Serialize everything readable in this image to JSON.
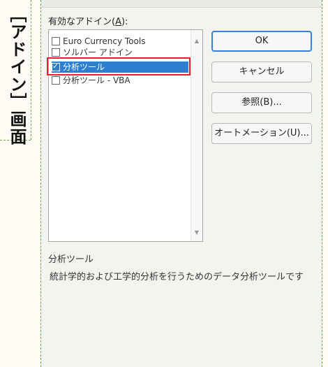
{
  "caption": "［アドイン］画面",
  "dialog": {
    "list_label": "有効なアドイン(",
    "list_label_key": "A",
    "list_label_end": "):",
    "addins": [
      {
        "label": "Euro Currency Tools",
        "checked": false,
        "selected": false
      },
      {
        "label": "ソルバー アドイン",
        "checked": false,
        "selected": false
      },
      {
        "label": "分析ツール",
        "checked": true,
        "selected": true
      },
      {
        "label": "分析ツール - VBA",
        "checked": false,
        "selected": false
      }
    ],
    "buttons": {
      "ok": "OK",
      "cancel": "キャンセル",
      "browse": "参照(B)...",
      "automation": "オートメーション(U)..."
    },
    "description": {
      "title": "分析ツール",
      "text": "統計学的および工学的分析を行うためのデータ分析ツールです"
    }
  },
  "colors": {
    "selection": "#2d7fd1",
    "highlight_frame": "#e0242f",
    "guide": "#6aa84f",
    "default_button_border": "#3c7fd5"
  }
}
